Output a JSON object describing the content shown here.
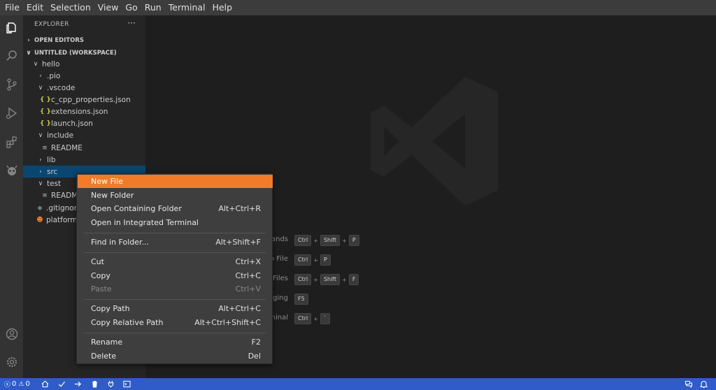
{
  "menubar": {
    "items": [
      "File",
      "Edit",
      "Selection",
      "View",
      "Go",
      "Run",
      "Terminal",
      "Help"
    ]
  },
  "activitybar": {
    "icons": [
      "files-icon",
      "search-icon",
      "source-control-icon",
      "run-debug-icon",
      "extensions-icon",
      "platformio-icon",
      "account-icon",
      "settings-gear-icon"
    ]
  },
  "sidebar": {
    "title": "EXPLORER",
    "more": "···",
    "open_editors": "OPEN EDITORS",
    "workspace": "UNTITLED (WORKSPACE)",
    "tree": [
      {
        "label": "hello",
        "chev": "∨",
        "icon": ""
      },
      {
        "label": ".pio",
        "chev": "›",
        "icon": ""
      },
      {
        "label": ".vscode",
        "chev": "∨",
        "icon": ""
      },
      {
        "label": "c_cpp_properties.json",
        "chev": "",
        "icon": "{ }"
      },
      {
        "label": "extensions.json",
        "chev": "",
        "icon": "{ }"
      },
      {
        "label": "launch.json",
        "chev": "",
        "icon": "{ }"
      },
      {
        "label": "include",
        "chev": "∨",
        "icon": ""
      },
      {
        "label": "README",
        "chev": "",
        "icon": "≡"
      },
      {
        "label": "lib",
        "chev": "›",
        "icon": ""
      },
      {
        "label": "src",
        "chev": "›",
        "icon": ""
      },
      {
        "label": "test",
        "chev": "∨",
        "icon": ""
      },
      {
        "label": "README",
        "chev": "",
        "icon": "≡"
      },
      {
        "label": ".gitignore",
        "chev": "",
        "icon": "◆"
      },
      {
        "label": "platformio.ini",
        "chev": "",
        "icon": "☻"
      }
    ]
  },
  "context_menu": {
    "items": [
      {
        "label": "New File",
        "accel": ""
      },
      {
        "label": "New Folder",
        "accel": ""
      },
      {
        "label": "Open Containing Folder",
        "accel": "Alt+Ctrl+R"
      },
      {
        "label": "Open in Integrated Terminal",
        "accel": ""
      },
      {
        "label": "Find in Folder...",
        "accel": "Alt+Shift+F"
      },
      {
        "label": "Cut",
        "accel": "Ctrl+X"
      },
      {
        "label": "Copy",
        "accel": "Ctrl+C"
      },
      {
        "label": "Paste",
        "accel": "Ctrl+V"
      },
      {
        "label": "Copy Path",
        "accel": "Alt+Ctrl+C"
      },
      {
        "label": "Copy Relative Path",
        "accel": "Alt+Ctrl+Shift+C"
      },
      {
        "label": "Rename",
        "accel": "F2"
      },
      {
        "label": "Delete",
        "accel": "Del"
      }
    ]
  },
  "shortcuts": [
    {
      "label": "Show All Commands",
      "keys": [
        "Ctrl",
        "Shift",
        "P"
      ]
    },
    {
      "label": "Go to File",
      "keys": [
        "Ctrl",
        "P"
      ]
    },
    {
      "label": "Find in Files",
      "keys": [
        "Ctrl",
        "Shift",
        "F"
      ]
    },
    {
      "label": "Start Debugging",
      "keys": [
        "F5"
      ]
    },
    {
      "label": "Toggle Terminal",
      "keys": [
        "Ctrl",
        "`"
      ]
    }
  ],
  "statusbar": {
    "errors": "0",
    "warnings": "0",
    "icons": [
      "home-icon",
      "check-icon",
      "arrow-right-icon",
      "trash-icon",
      "plug-icon",
      "terminal-icon",
      "feedback-icon",
      "bell-icon"
    ]
  },
  "colors": {
    "statusbar": "#2f5cc8",
    "menu_highlight": "#f07c2a",
    "selection": "#094771"
  }
}
